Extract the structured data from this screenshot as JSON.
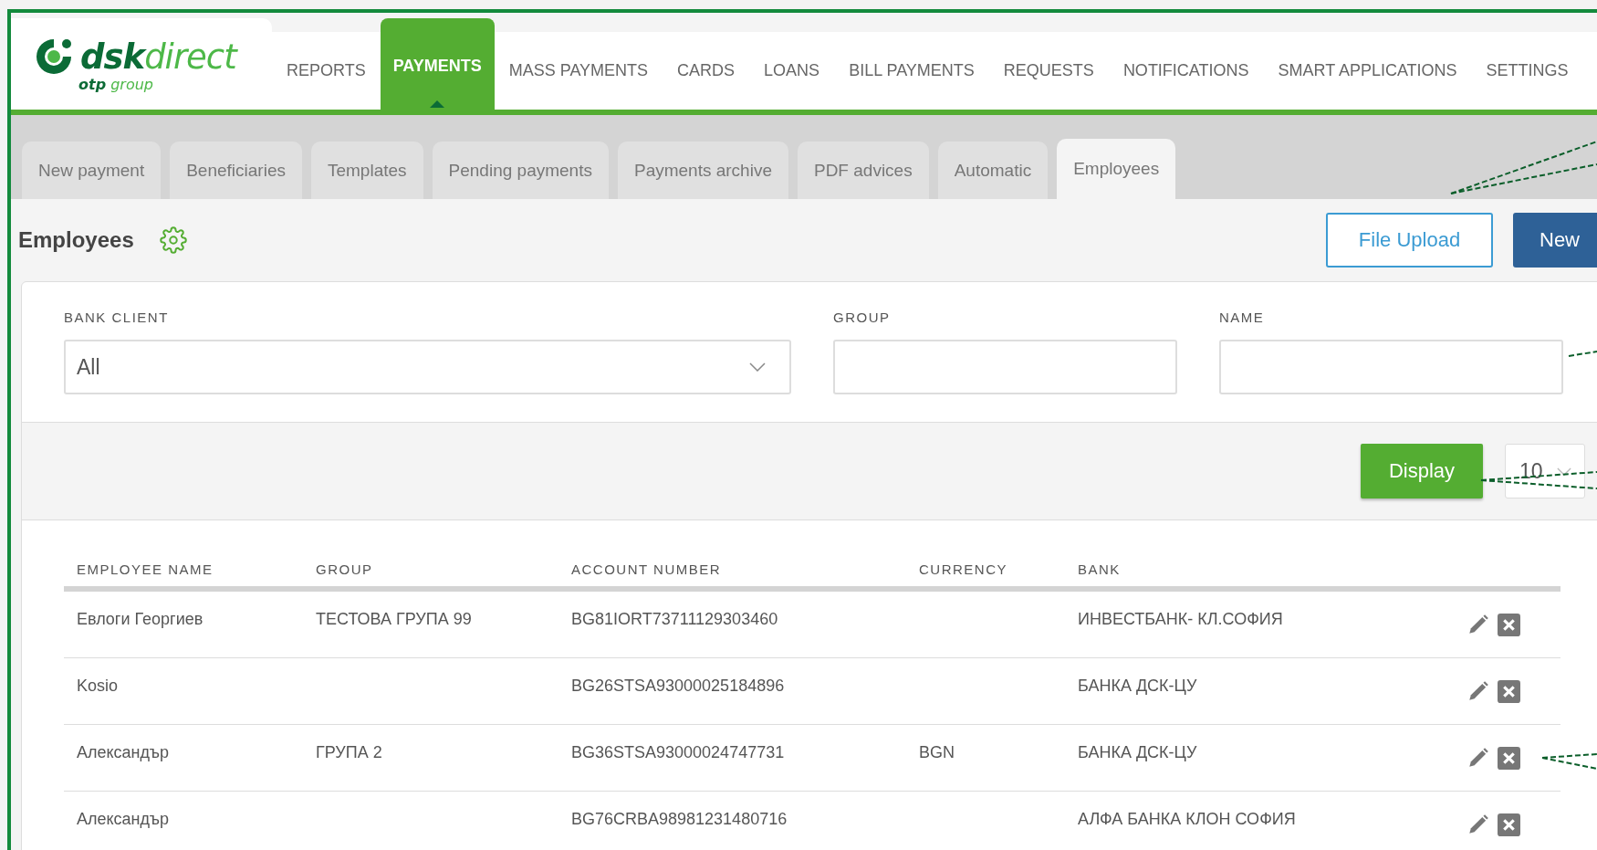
{
  "logo": {
    "brand": "dsk",
    "brand_accent": "direct",
    "tagline": "otp group"
  },
  "nav": [
    {
      "label": "REPORTS",
      "selected": false
    },
    {
      "label": "PAYMENTS",
      "selected": true
    },
    {
      "label": "MASS PAYMENTS",
      "selected": false
    },
    {
      "label": "CARDS",
      "selected": false
    },
    {
      "label": "LOANS",
      "selected": false
    },
    {
      "label": "BILL PAYMENTS",
      "selected": false
    },
    {
      "label": "REQUESTS",
      "selected": false
    },
    {
      "label": "NOTIFICATIONS",
      "selected": false
    },
    {
      "label": "SMART APPLICATIONS",
      "selected": false
    },
    {
      "label": "SETTINGS",
      "selected": false
    }
  ],
  "tabs": [
    {
      "label": "New payment",
      "selected": false
    },
    {
      "label": "Beneficiaries",
      "selected": false
    },
    {
      "label": "Templates",
      "selected": false
    },
    {
      "label": "Pending payments",
      "selected": false
    },
    {
      "label": "Payments archive",
      "selected": false
    },
    {
      "label": "PDF advices",
      "selected": false
    },
    {
      "label": "Automatic",
      "selected": false
    },
    {
      "label": "Employees",
      "selected": true
    }
  ],
  "page": {
    "title": "Employees"
  },
  "actions": [
    {
      "label": "File Upload",
      "kind": "outline"
    },
    {
      "label": "New",
      "kind": "primary"
    }
  ],
  "filters": [
    {
      "label": "BANK CLIENT",
      "kind": "select",
      "value": "All"
    },
    {
      "label": "GROUP",
      "kind": "input"
    },
    {
      "label": "NAME",
      "kind": "input"
    }
  ],
  "display_button": "Display",
  "page_size": "10",
  "table": {
    "columns": [
      "EMPLOYEE NAME",
      "GROUP",
      "ACCOUNT NUMBER",
      "CURRENCY",
      "BANK"
    ],
    "rows": [
      {
        "cells": [
          "Евлоги Георгиев",
          "ТЕСТОВА ГРУПА 99",
          "BG81IORT73711129303460",
          "",
          "ИНВЕСТБАНК- КЛ.СОФИЯ"
        ]
      },
      {
        "cells": [
          "Kosio",
          "",
          "BG26STSA93000025184896",
          "",
          "БАНКА ДСК-ЦУ"
        ]
      },
      {
        "cells": [
          "Александър",
          "ГРУПА 2",
          "BG36STSA93000024747731",
          "BGN",
          "БАНКА ДСК-ЦУ"
        ]
      },
      {
        "cells": [
          "Александър",
          "",
          "BG76CRBA98981231480716",
          "",
          "АЛФА БАНКА КЛОН СОФИЯ"
        ]
      }
    ]
  }
}
